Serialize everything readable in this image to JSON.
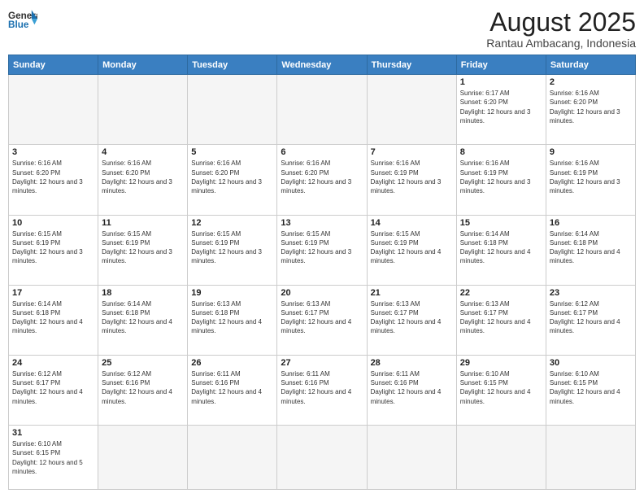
{
  "header": {
    "logo_general": "General",
    "logo_blue": "Blue",
    "month_year": "August 2025",
    "location": "Rantau Ambacang, Indonesia"
  },
  "days_of_week": [
    "Sunday",
    "Monday",
    "Tuesday",
    "Wednesday",
    "Thursday",
    "Friday",
    "Saturday"
  ],
  "weeks": [
    [
      {
        "day": "",
        "info": ""
      },
      {
        "day": "",
        "info": ""
      },
      {
        "day": "",
        "info": ""
      },
      {
        "day": "",
        "info": ""
      },
      {
        "day": "",
        "info": ""
      },
      {
        "day": "1",
        "info": "Sunrise: 6:17 AM\nSunset: 6:20 PM\nDaylight: 12 hours and 3 minutes."
      },
      {
        "day": "2",
        "info": "Sunrise: 6:16 AM\nSunset: 6:20 PM\nDaylight: 12 hours and 3 minutes."
      }
    ],
    [
      {
        "day": "3",
        "info": "Sunrise: 6:16 AM\nSunset: 6:20 PM\nDaylight: 12 hours and 3 minutes."
      },
      {
        "day": "4",
        "info": "Sunrise: 6:16 AM\nSunset: 6:20 PM\nDaylight: 12 hours and 3 minutes."
      },
      {
        "day": "5",
        "info": "Sunrise: 6:16 AM\nSunset: 6:20 PM\nDaylight: 12 hours and 3 minutes."
      },
      {
        "day": "6",
        "info": "Sunrise: 6:16 AM\nSunset: 6:20 PM\nDaylight: 12 hours and 3 minutes."
      },
      {
        "day": "7",
        "info": "Sunrise: 6:16 AM\nSunset: 6:19 PM\nDaylight: 12 hours and 3 minutes."
      },
      {
        "day": "8",
        "info": "Sunrise: 6:16 AM\nSunset: 6:19 PM\nDaylight: 12 hours and 3 minutes."
      },
      {
        "day": "9",
        "info": "Sunrise: 6:16 AM\nSunset: 6:19 PM\nDaylight: 12 hours and 3 minutes."
      }
    ],
    [
      {
        "day": "10",
        "info": "Sunrise: 6:15 AM\nSunset: 6:19 PM\nDaylight: 12 hours and 3 minutes."
      },
      {
        "day": "11",
        "info": "Sunrise: 6:15 AM\nSunset: 6:19 PM\nDaylight: 12 hours and 3 minutes."
      },
      {
        "day": "12",
        "info": "Sunrise: 6:15 AM\nSunset: 6:19 PM\nDaylight: 12 hours and 3 minutes."
      },
      {
        "day": "13",
        "info": "Sunrise: 6:15 AM\nSunset: 6:19 PM\nDaylight: 12 hours and 3 minutes."
      },
      {
        "day": "14",
        "info": "Sunrise: 6:15 AM\nSunset: 6:19 PM\nDaylight: 12 hours and 4 minutes."
      },
      {
        "day": "15",
        "info": "Sunrise: 6:14 AM\nSunset: 6:18 PM\nDaylight: 12 hours and 4 minutes."
      },
      {
        "day": "16",
        "info": "Sunrise: 6:14 AM\nSunset: 6:18 PM\nDaylight: 12 hours and 4 minutes."
      }
    ],
    [
      {
        "day": "17",
        "info": "Sunrise: 6:14 AM\nSunset: 6:18 PM\nDaylight: 12 hours and 4 minutes."
      },
      {
        "day": "18",
        "info": "Sunrise: 6:14 AM\nSunset: 6:18 PM\nDaylight: 12 hours and 4 minutes."
      },
      {
        "day": "19",
        "info": "Sunrise: 6:13 AM\nSunset: 6:18 PM\nDaylight: 12 hours and 4 minutes."
      },
      {
        "day": "20",
        "info": "Sunrise: 6:13 AM\nSunset: 6:17 PM\nDaylight: 12 hours and 4 minutes."
      },
      {
        "day": "21",
        "info": "Sunrise: 6:13 AM\nSunset: 6:17 PM\nDaylight: 12 hours and 4 minutes."
      },
      {
        "day": "22",
        "info": "Sunrise: 6:13 AM\nSunset: 6:17 PM\nDaylight: 12 hours and 4 minutes."
      },
      {
        "day": "23",
        "info": "Sunrise: 6:12 AM\nSunset: 6:17 PM\nDaylight: 12 hours and 4 minutes."
      }
    ],
    [
      {
        "day": "24",
        "info": "Sunrise: 6:12 AM\nSunset: 6:17 PM\nDaylight: 12 hours and 4 minutes."
      },
      {
        "day": "25",
        "info": "Sunrise: 6:12 AM\nSunset: 6:16 PM\nDaylight: 12 hours and 4 minutes."
      },
      {
        "day": "26",
        "info": "Sunrise: 6:11 AM\nSunset: 6:16 PM\nDaylight: 12 hours and 4 minutes."
      },
      {
        "day": "27",
        "info": "Sunrise: 6:11 AM\nSunset: 6:16 PM\nDaylight: 12 hours and 4 minutes."
      },
      {
        "day": "28",
        "info": "Sunrise: 6:11 AM\nSunset: 6:16 PM\nDaylight: 12 hours and 4 minutes."
      },
      {
        "day": "29",
        "info": "Sunrise: 6:10 AM\nSunset: 6:15 PM\nDaylight: 12 hours and 4 minutes."
      },
      {
        "day": "30",
        "info": "Sunrise: 6:10 AM\nSunset: 6:15 PM\nDaylight: 12 hours and 4 minutes."
      }
    ],
    [
      {
        "day": "31",
        "info": "Sunrise: 6:10 AM\nSunset: 6:15 PM\nDaylight: 12 hours and 5 minutes."
      },
      {
        "day": "",
        "info": ""
      },
      {
        "day": "",
        "info": ""
      },
      {
        "day": "",
        "info": ""
      },
      {
        "day": "",
        "info": ""
      },
      {
        "day": "",
        "info": ""
      },
      {
        "day": "",
        "info": ""
      }
    ]
  ]
}
